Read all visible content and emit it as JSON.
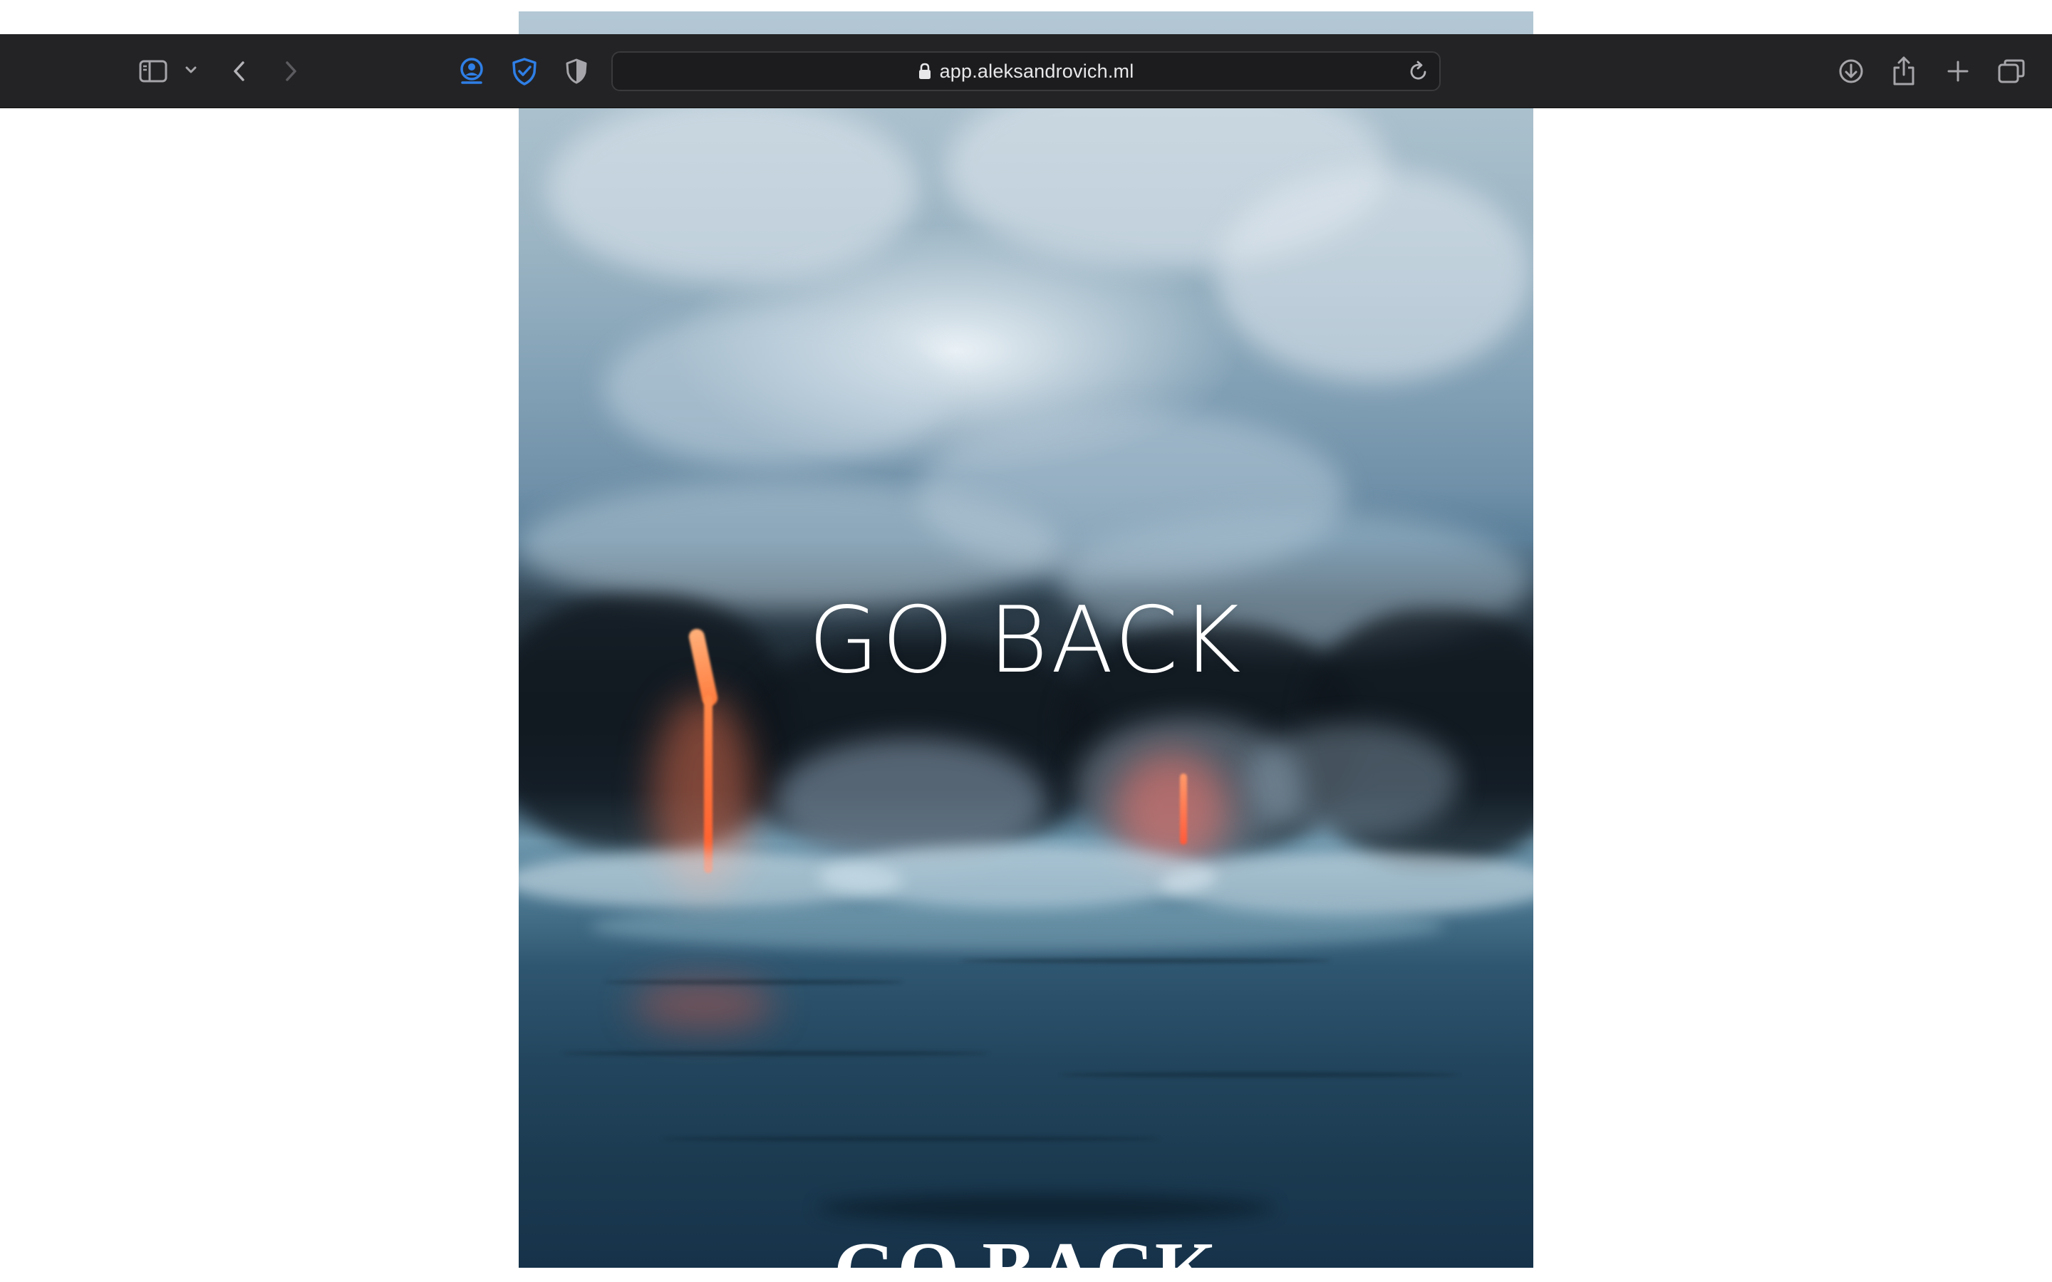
{
  "browser": {
    "url": "app.aleksandrovich.ml",
    "icons": {
      "sidebar": "sidebar-icon",
      "sidebar_menu": "chevron-down-icon",
      "back": "chevron-left-icon",
      "forward": "chevron-right-icon",
      "extension_1": "globe-person-icon",
      "extension_2": "shield-check-icon",
      "privacy": "half-shield-icon",
      "lock": "lock-icon",
      "reload": "reload-icon",
      "downloads": "download-icon",
      "share": "share-icon",
      "new_tab": "plus-icon",
      "tabs_overview": "tabs-icon"
    },
    "colors": {
      "toolbar": "#232325",
      "close": "#ff5f57",
      "minimize": "#4a4a4c",
      "zoom": "#28c840",
      "extension_accent": "#2f7fe6"
    }
  },
  "page": {
    "hero_heading": "GO BACK",
    "hero_heading_secondary": "GO BACK"
  }
}
